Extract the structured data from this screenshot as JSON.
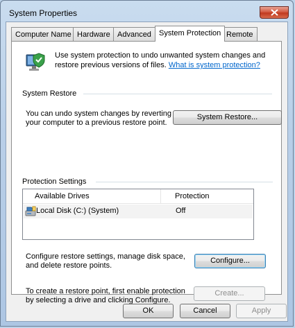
{
  "window": {
    "title": "System Properties"
  },
  "tabs": [
    {
      "label": "Computer Name"
    },
    {
      "label": "Hardware"
    },
    {
      "label": "Advanced"
    },
    {
      "label": "System Protection",
      "active": true
    },
    {
      "label": "Remote"
    }
  ],
  "intro": {
    "text": "Use system protection to undo unwanted system changes and restore previous versions of files.",
    "link": "What is system protection?"
  },
  "system_restore": {
    "heading": "System Restore",
    "description_line1": "You can undo system changes by reverting",
    "description_line2": "your computer to a previous restore point.",
    "button": "System Restore..."
  },
  "protection": {
    "heading": "Protection Settings",
    "columns": [
      "Available Drives",
      "Protection"
    ],
    "rows": [
      {
        "drive": "Local Disk (C:) (System)",
        "protection": "Off"
      }
    ],
    "configure_text_line1": "Configure restore settings, manage disk space,",
    "configure_text_line2": "and delete restore points.",
    "configure_button": "Configure...",
    "create_text_line1": "To create a restore point, first enable protection",
    "create_text_line2": "by selecting a drive and clicking Configure.",
    "create_button": "Create..."
  },
  "footer": {
    "ok": "OK",
    "cancel": "Cancel",
    "apply": "Apply"
  },
  "colors": {
    "link": "#0066cc",
    "close_button": "#c0391f"
  },
  "icons": [
    "computer-shield-icon",
    "close-icon",
    "drive-icon"
  ]
}
